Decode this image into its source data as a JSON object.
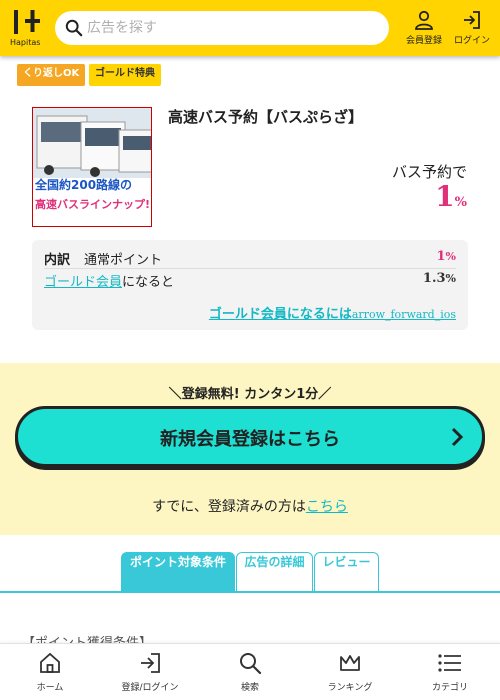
{
  "header": {
    "logo_text": "Hapitas",
    "search_placeholder": "広告を探す",
    "register_label": "会員登録",
    "login_label": "ログイン"
  },
  "tags": [
    "くり返しOK",
    "ゴールド特典"
  ],
  "ad": {
    "title": "高速バス予約【バスぷらざ】",
    "banner_line1": "全国約200路線の",
    "banner_line2": "高速バスラインナップ!",
    "reward_label": "バス予約で",
    "reward_value": "1",
    "reward_unit": "%"
  },
  "breakdown": {
    "key": "内訳",
    "normal_label": "通常ポイント",
    "normal_value": "1",
    "normal_unit": "%",
    "gold_link": "ゴールド会員",
    "gold_suffix": "になると",
    "gold_value": "1.3",
    "gold_unit": "%",
    "more_link": "ゴールド会員になるには",
    "more_icon": "arrow_forward_ios"
  },
  "registration": {
    "catch": "＼登録無料! カンタン1分／",
    "button_label": "新規会員登録はこちら",
    "login_prefix": "すでに、登録済みの方は",
    "login_link": "こちら"
  },
  "tabs": [
    "ポイント対象条件",
    "広告の詳細",
    "レビュー"
  ],
  "conditions_heading": "【ポイント獲得条件】",
  "bottom_nav": [
    "ホーム",
    "登録/ログイン",
    "検索",
    "ランキング",
    "カテゴリ"
  ],
  "colors": {
    "brand_yellow": "#ffd400",
    "accent_cyan": "#1de0d2",
    "link_teal": "#13b8c5",
    "reward_pink": "#e0307a"
  }
}
